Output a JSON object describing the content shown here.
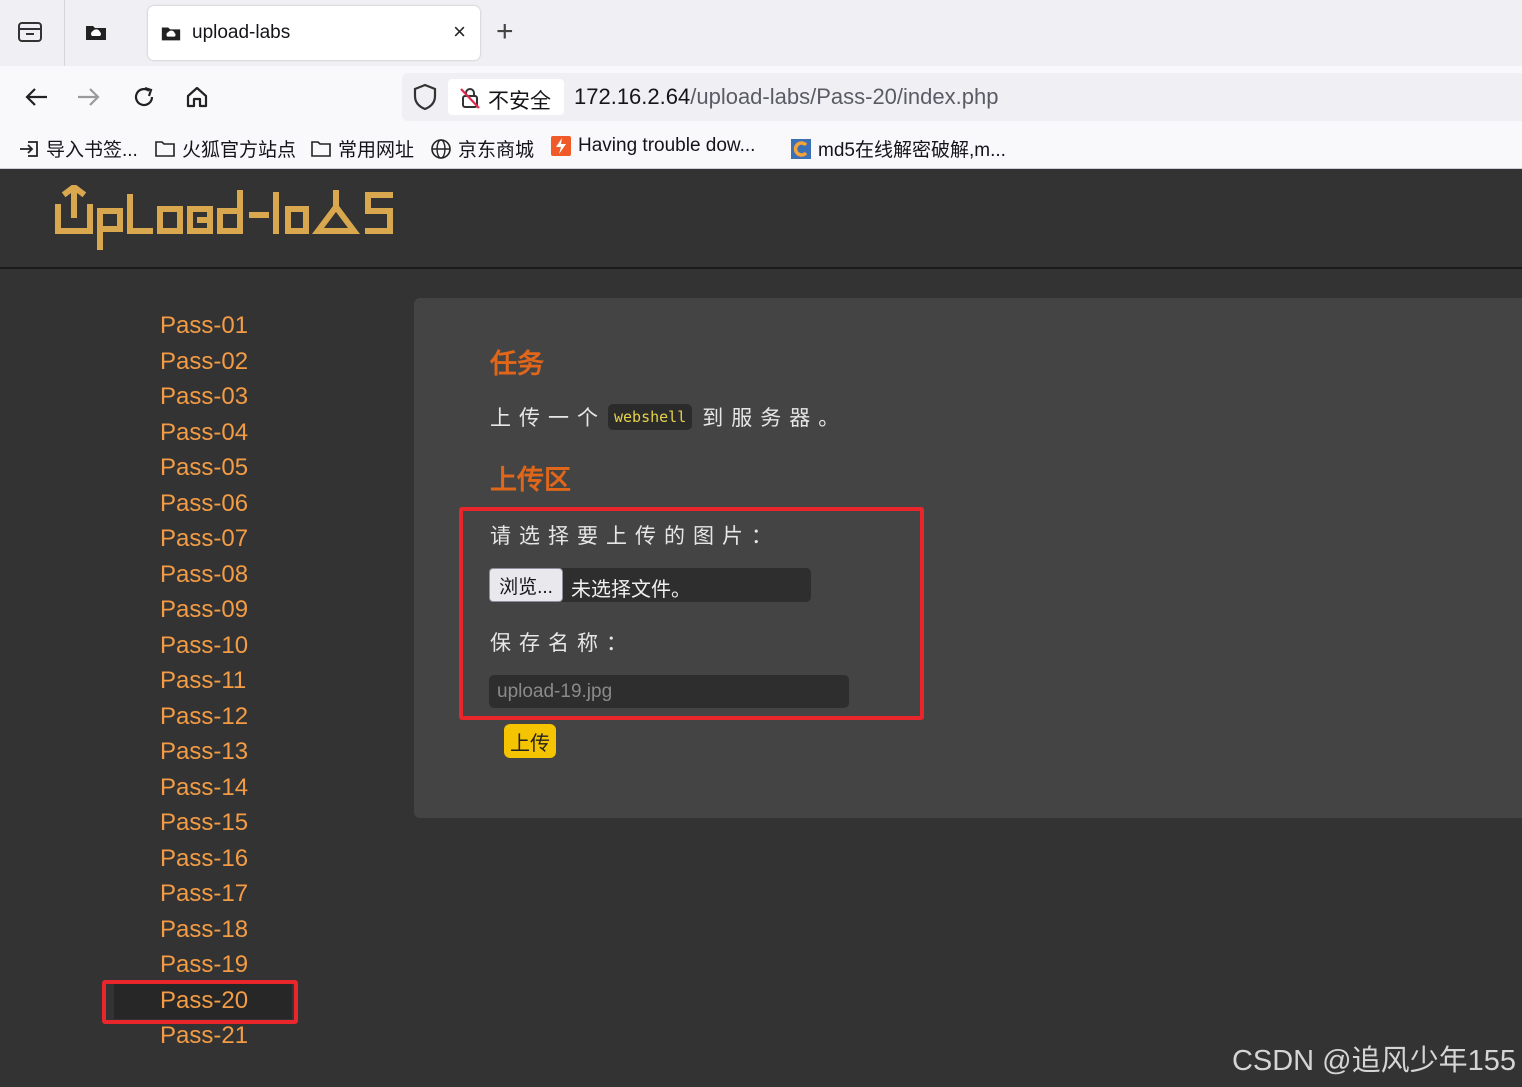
{
  "browser": {
    "tab_title": "upload-labs",
    "tab_close": "×",
    "new_tab": "+",
    "security_label": "不安全",
    "url_host": "172.16.2.64",
    "url_path": "/upload-labs/Pass-20/index.php",
    "bookmarks": [
      {
        "label": "导入书签...",
        "icon": "import-icon"
      },
      {
        "label": "火狐官方站点",
        "icon": "folder-icon"
      },
      {
        "label": "常用网址",
        "icon": "folder-icon"
      },
      {
        "label": "京东商城",
        "icon": "globe-icon"
      },
      {
        "label": "Having trouble dow...",
        "icon": "bolt-favicon"
      },
      {
        "label": "md5在线解密破解,m...",
        "icon": "cmd5-favicon"
      }
    ]
  },
  "page": {
    "logo_text": "upload-labs",
    "menu": [
      "Pass-01",
      "Pass-02",
      "Pass-03",
      "Pass-04",
      "Pass-05",
      "Pass-06",
      "Pass-07",
      "Pass-08",
      "Pass-09",
      "Pass-10",
      "Pass-11",
      "Pass-12",
      "Pass-13",
      "Pass-14",
      "Pass-15",
      "Pass-16",
      "Pass-17",
      "Pass-18",
      "Pass-19",
      "Pass-20",
      "Pass-21"
    ],
    "active_menu": "Pass-20",
    "task_heading": "任务",
    "task_prefix": "上传一个",
    "task_code": "webshell",
    "task_suffix": "到服务器。",
    "upload_heading": "上传区",
    "choose_label": "请选择要上传的图片：",
    "browse_button": "浏览...",
    "no_file_text": "未选择文件。",
    "save_name_label": "保存名称：",
    "save_name_placeholder": "upload-19.jpg",
    "submit_button": "上传"
  },
  "watermark": "CSDN @追风少年155",
  "colors": {
    "accent_orange": "#e0661a",
    "menu_orange": "#f39c45",
    "submit_yellow": "#f5c400",
    "annotation_red": "#e8262b",
    "page_bg": "#333333",
    "panel_bg": "#444444"
  }
}
